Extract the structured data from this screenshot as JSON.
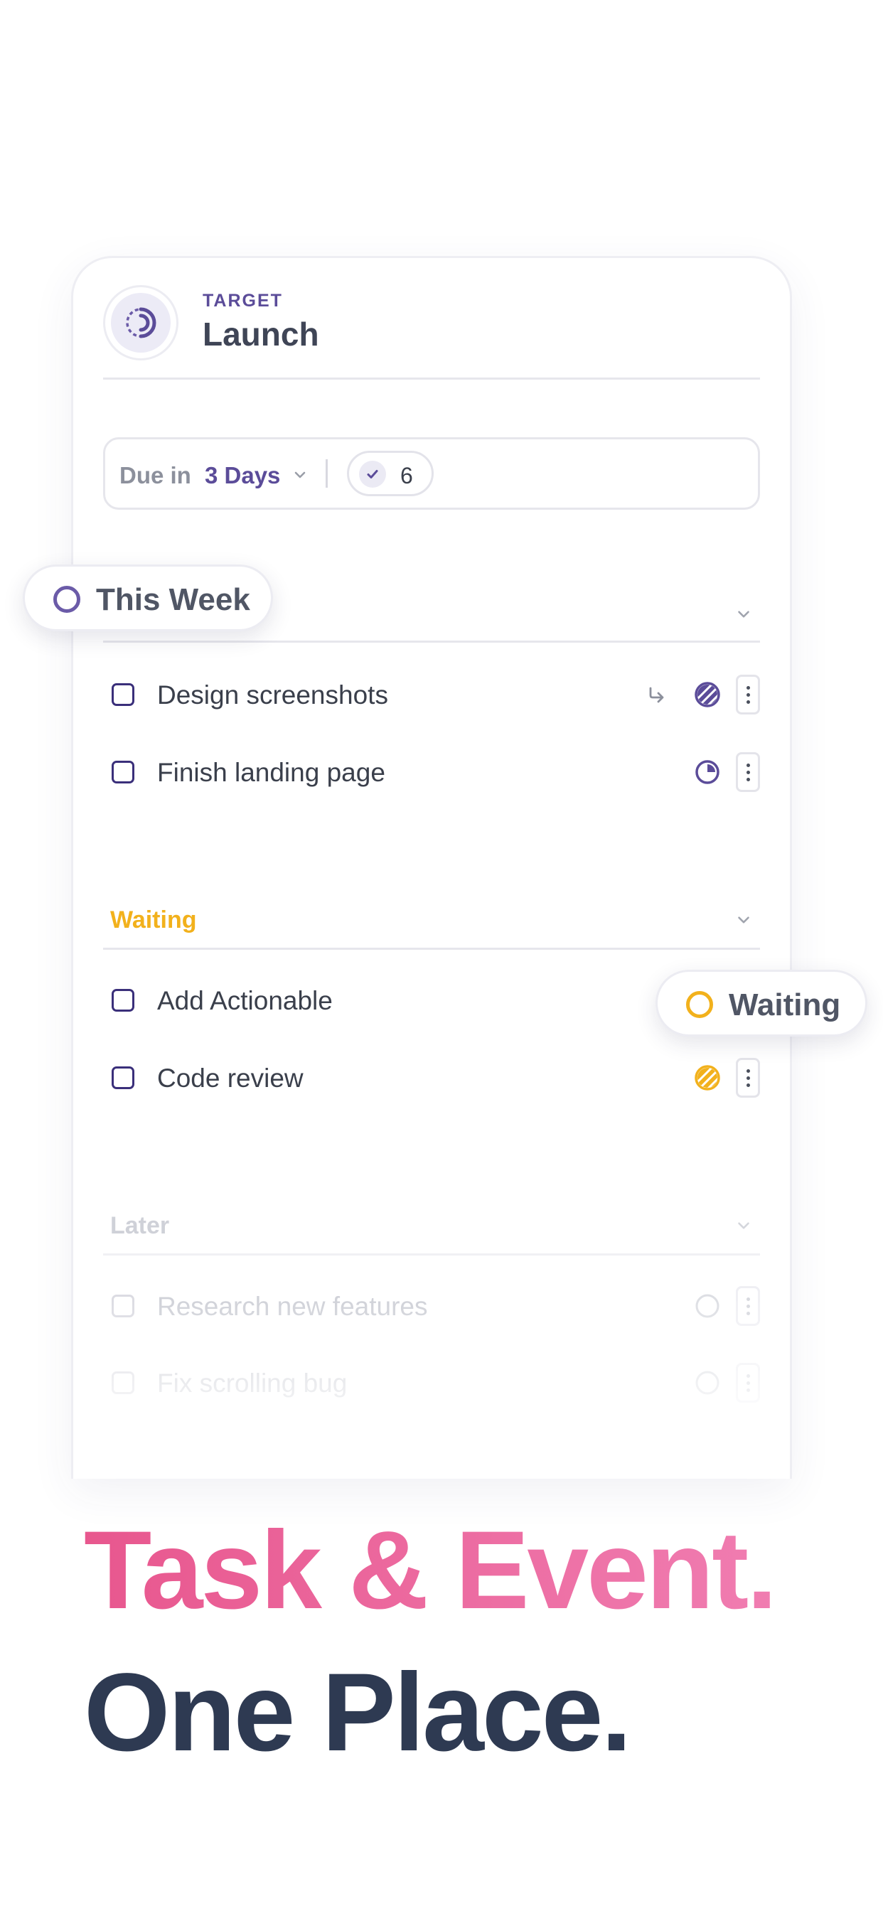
{
  "target": {
    "kicker": "TARGET",
    "title": "Launch",
    "icon": "target-progress-icon"
  },
  "due": {
    "prefix": "Due in",
    "value": "3 Days",
    "count": "6"
  },
  "float_pills": {
    "this_week": "This Week",
    "waiting": "Waiting"
  },
  "sections": {
    "this_week": {
      "tasks": [
        {
          "label": "Design screenshots",
          "status_icon": "hatched-circle-icon",
          "has_arrow": true
        },
        {
          "label": "Finish landing page",
          "status_icon": "pie-quarter-icon",
          "has_arrow": false
        }
      ]
    },
    "waiting": {
      "title": "Waiting",
      "tasks": [
        {
          "label": "Add Actionable"
        },
        {
          "label": "Code review",
          "status_icon": "hatched-circle-icon"
        }
      ]
    },
    "later": {
      "title": "Later",
      "tasks": [
        {
          "label": "Research new features",
          "status_icon": "empty-circle-icon"
        },
        {
          "label": "Fix scrolling bug",
          "status_icon": "empty-circle-icon"
        }
      ]
    }
  },
  "headline": {
    "line1": "Task & Event.",
    "line2": "One Place."
  },
  "colors": {
    "accent": "#5b4c99",
    "waiting": "#f2b11c",
    "pink": "#ec6a9f",
    "navy": "#2e3a52"
  }
}
